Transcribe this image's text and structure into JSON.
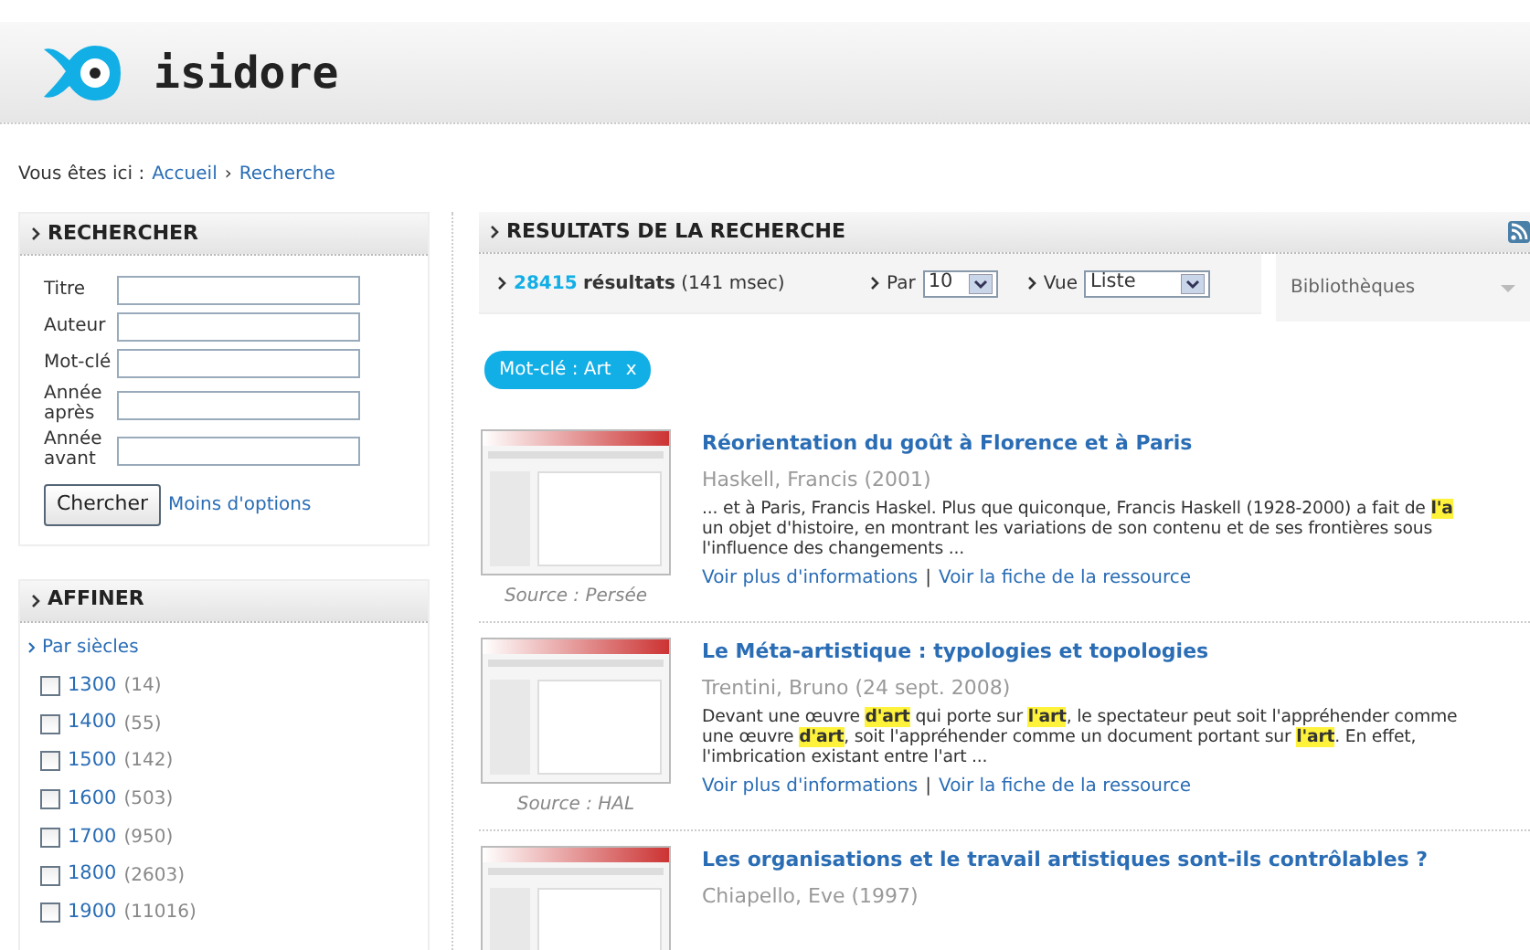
{
  "header": {
    "logo_text": "isidore"
  },
  "breadcrumb": {
    "label": "Vous êtes ici :",
    "separator": "›",
    "items": [
      {
        "label": "Accueil"
      },
      {
        "label": "Recherche"
      }
    ]
  },
  "search_panel": {
    "title": "RECHERCHER",
    "fields": [
      {
        "label": "Titre"
      },
      {
        "label": "Auteur"
      },
      {
        "label": "Mot-clé"
      },
      {
        "label": "Année après"
      },
      {
        "label": "Année avant"
      }
    ],
    "submit": "Chercher",
    "options_link": "Moins d'options"
  },
  "refine_panel": {
    "title": "AFFINER",
    "group": "Par siècles",
    "items": [
      {
        "label": "1300",
        "count": "(14)",
        "checked": false
      },
      {
        "label": "1400",
        "count": "(55)",
        "checked": false
      },
      {
        "label": "1500",
        "count": "(142)",
        "checked": false
      },
      {
        "label": "1600",
        "count": "(503)",
        "checked": false
      },
      {
        "label": "1700",
        "count": "(950)",
        "checked": false
      },
      {
        "label": "1800",
        "count": "(2603)",
        "checked": false
      },
      {
        "label": "1900",
        "count": "(11016)",
        "checked": false
      }
    ]
  },
  "results": {
    "title": "RESULTATS DE LA RECHERCHE",
    "count": "28415",
    "count_label": "résultats",
    "timing": "(141 msec)",
    "per_page": {
      "label": "Par",
      "value": "10"
    },
    "view": {
      "label": "Vue",
      "value": "Liste"
    },
    "libraries": {
      "label": "Bibliothèques"
    },
    "filters": [
      {
        "label": "Mot-clé : Art",
        "remove": "x"
      }
    ],
    "items": [
      {
        "title": "Réorientation du goût à Florence et à Paris",
        "meta": "Haskell, Francis (2001)",
        "description_lines": [
          "... et à Paris, Francis Haskel. Plus que quiconque, Francis Haskell (1928-2000) a fait de **l'a**",
          "un objet d'histoire, en montrant les variations de son contenu et de ses frontières sous",
          "l'influence des changements ..."
        ],
        "links": [
          "Voir plus d'informations",
          "Voir la fiche de la ressource"
        ],
        "separator": "|",
        "source": "Source : Persée"
      },
      {
        "title": "Le Méta-artistique : typologies et topologies",
        "meta": "Trentini, Bruno (24 sept. 2008)",
        "description_lines": [
          "Devant une œuvre **d'art** qui porte sur **l'art**, le spectateur peut soit l'appréhender comme",
          "une œuvre **d'art**, soit l'appréhender comme un document portant sur **l'art**. En effet,",
          "l'imbrication existant entre l'art ..."
        ],
        "links": [
          "Voir plus d'informations",
          "Voir la fiche de la ressource"
        ],
        "separator": "|",
        "source": "Source : HAL"
      },
      {
        "title": "Les organisations et le travail artistiques sont-ils contrôlables ?",
        "meta": "Chiapello, Eve (1997)"
      }
    ]
  }
}
